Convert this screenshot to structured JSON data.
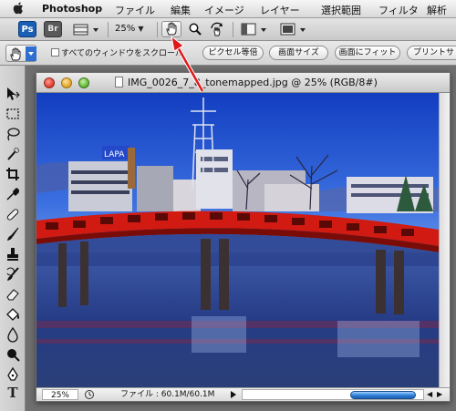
{
  "menubar": {
    "apple": "",
    "app_name": "Photoshop",
    "items": [
      "ファイル",
      "編集",
      "イメージ",
      "レイヤー",
      "選択範囲",
      "フィルタ",
      "解析"
    ]
  },
  "appbar": {
    "ps_logo": "Ps",
    "br_logo": "Br",
    "zoom": "25%"
  },
  "optbar": {
    "scroll_all_label": "すべてのウィンドウをスクロール",
    "buttons": [
      "ピクセル等倍",
      "画面サイズ",
      "画面にフィット",
      "プリントサ"
    ]
  },
  "document": {
    "title": "IMG_0026_7_8_tonemapped.jpg @ 25% (RGB/8#)"
  },
  "statusbar": {
    "zoom": "25%",
    "file_info": "ファイル : 60.1M/60.1M"
  },
  "photo_sign": "LAPA"
}
